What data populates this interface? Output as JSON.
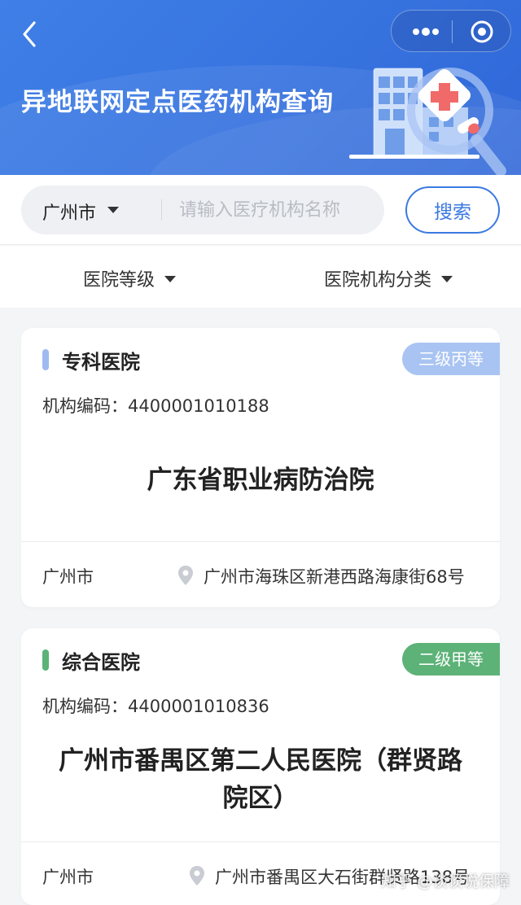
{
  "header": {
    "title": "异地联网定点医药机构查询",
    "back_icon": "chevron-left-icon",
    "more_icon": "more-dots-icon",
    "close_icon": "target-circle-icon"
  },
  "search": {
    "city": "广州市",
    "placeholder": "请输入医疗机构名称",
    "value": "",
    "button_label": "搜索"
  },
  "filters": {
    "level_label": "医院等级",
    "type_label": "医院机构分类"
  },
  "colors": {
    "primary": "#3b79e2",
    "badge_tertiary": "#a9c4f2",
    "badge_secondary": "#5cb277",
    "type_bar_blue": "#9fbaf0",
    "type_bar_green": "#5cb277"
  },
  "hospitals": [
    {
      "type": "专科医院",
      "grade": "三级丙等",
      "code": "机构编码：4400001010188",
      "name": "广东省职业病防治院",
      "city": "广州市",
      "address": "广州市海珠区新港西路海康街68号"
    },
    {
      "type": "综合医院",
      "grade": "二级甲等",
      "code": "机构编码：4400001010836",
      "name_line1": "广州市番禺区第二人民医院（群贤路",
      "name_line2": "院区）",
      "city": "广州市",
      "address": "广州市番禺区大石街群贤路138号"
    }
  ],
  "watermark": "知乎 @谈谈说保障"
}
